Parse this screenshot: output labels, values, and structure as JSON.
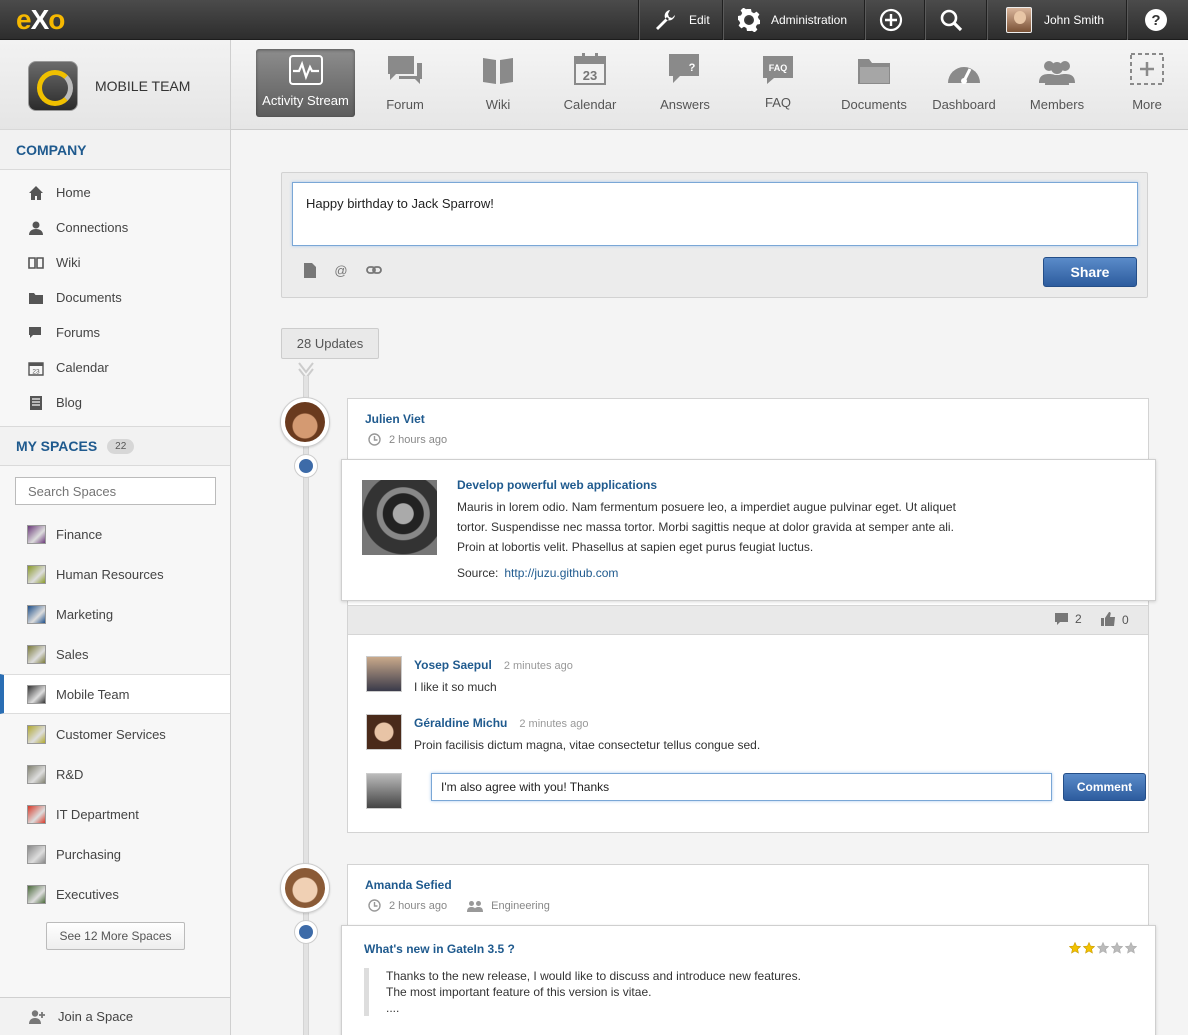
{
  "topbar": {
    "logo_e": "e",
    "logo_x": "X",
    "logo_o": "o",
    "edit_label": "Edit",
    "admin_label": "Administration",
    "user_name": "John Smith"
  },
  "sidebar": {
    "space_name": "MOBILE TEAM",
    "company_title": "COMPANY",
    "company_items": [
      {
        "label": "Home"
      },
      {
        "label": "Connections"
      },
      {
        "label": "Wiki"
      },
      {
        "label": "Documents"
      },
      {
        "label": "Forums"
      },
      {
        "label": "Calendar"
      },
      {
        "label": "Blog"
      }
    ],
    "my_spaces_title": "MY SPACES",
    "my_spaces_count": "22",
    "search_placeholder": "Search Spaces",
    "spaces": [
      {
        "label": "Finance",
        "color": "#6b3a7a"
      },
      {
        "label": "Human Resources",
        "color": "#8a9a2a"
      },
      {
        "label": "Marketing",
        "color": "#1e4f8a"
      },
      {
        "label": "Sales",
        "color": "#7a7a3a"
      },
      {
        "label": "Mobile Team",
        "color": "#333333"
      },
      {
        "label": "Customer Services",
        "color": "#b0a830"
      },
      {
        "label": "R&D",
        "color": "#808070"
      },
      {
        "label": "IT Department",
        "color": "#d83a2a"
      },
      {
        "label": "Purchasing",
        "color": "#888888"
      },
      {
        "label": "Executives",
        "color": "#4a6a3a"
      }
    ],
    "see_more_label": "See 12 More Spaces",
    "join_label": "Join a Space"
  },
  "apps": [
    {
      "label": "Activity Stream",
      "icon": "activity-icon"
    },
    {
      "label": "Forum",
      "icon": "forum-icon"
    },
    {
      "label": "Wiki",
      "icon": "wiki-icon"
    },
    {
      "label": "Calendar",
      "icon": "calendar-icon"
    },
    {
      "label": "Answers",
      "icon": "answers-icon"
    },
    {
      "label": "FAQ",
      "icon": "faq-icon"
    },
    {
      "label": "Documents",
      "icon": "documents-icon"
    },
    {
      "label": "Dashboard",
      "icon": "dashboard-icon"
    },
    {
      "label": "Members",
      "icon": "members-icon"
    },
    {
      "label": "More",
      "icon": "more-icon"
    }
  ],
  "calendar_day": "23",
  "faq_badge": "FAQ",
  "composer": {
    "value": "Happy birthday to Jack Sparrow!",
    "share_label": "Share"
  },
  "updates_label": "28 Updates",
  "activity1": {
    "author": "Julien Viet",
    "time": "2 hours ago",
    "link_title": "Develop powerful web applications",
    "link_desc": "Mauris in lorem odio. Nam fermentum posuere leo, a imperdiet augue pulvinar eget. Ut aliquet tortor. Suspendisse nec massa tortor. Morbi sagittis neque at dolor gravida at semper ante ali. Proin at lobortis velit. Phasellus at sapien eget purus feugiat luctus.",
    "source_label": "Source:",
    "source_url": "http://juzu.github.com",
    "comments_count": "2",
    "likes_count": "0",
    "comments": [
      {
        "name": "Yosep Saepul",
        "time": "2 minutes ago",
        "text": "I like it so much"
      },
      {
        "name": "Géraldine Michu",
        "time": "2 minutes ago",
        "text": "Proin facilisis dictum magna, vitae consectetur tellus congue sed."
      }
    ],
    "comment_input_value": "I'm also agree with you! Thanks",
    "comment_button": "Comment"
  },
  "activity2": {
    "author": "Amanda Sefied",
    "time": "2 hours ago",
    "department": "Engineering",
    "post_title": "What's new in GateIn 3.5 ?",
    "rating": 2,
    "rating_max": 5,
    "quote_line1": "Thanks to the new release, I would like to discuss and introduce new features.",
    "quote_line2": "The most important feature of this version is vitae.",
    "quote_line3": "...."
  }
}
